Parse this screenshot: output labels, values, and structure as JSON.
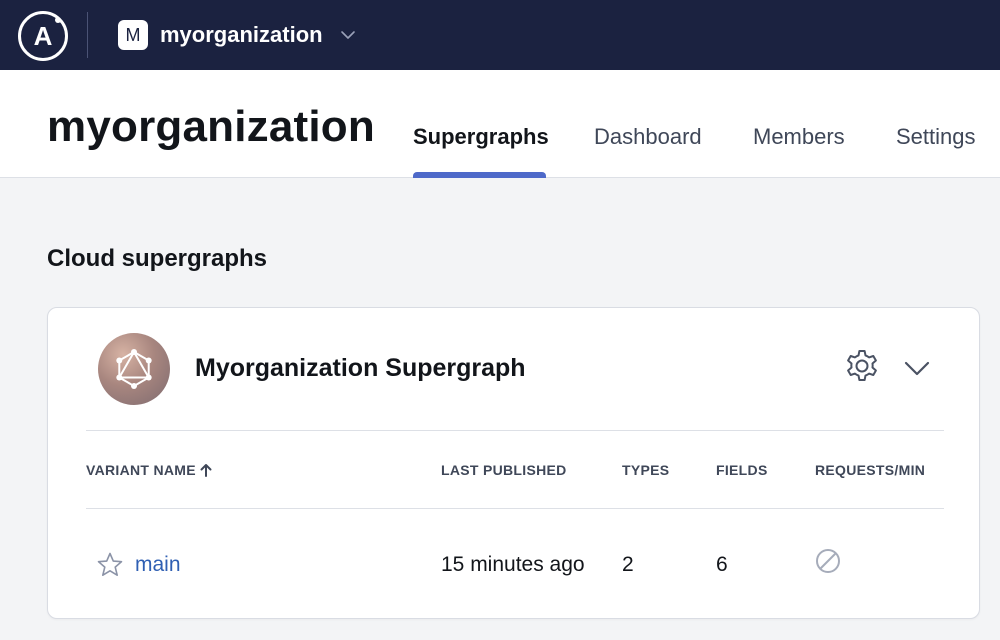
{
  "topbar": {
    "logo_letter": "A",
    "org_initial": "M",
    "org_name": "myorganization"
  },
  "header": {
    "title": "myorganization",
    "tabs": [
      {
        "label": "Supergraphs",
        "active": true
      },
      {
        "label": "Dashboard",
        "active": false
      },
      {
        "label": "Members",
        "active": false
      },
      {
        "label": "Settings",
        "active": false
      }
    ]
  },
  "section": {
    "title": "Cloud supergraphs"
  },
  "card": {
    "graph_name": "Myorganization Supergraph",
    "columns": {
      "variant_name": "VARIANT NAME",
      "last_published": "LAST PUBLISHED",
      "types": "TYPES",
      "fields": "FIELDS",
      "requests_min": "REQUESTS/MIN"
    },
    "rows": [
      {
        "variant": "main",
        "last_published": "15 minutes ago",
        "types": "2",
        "fields": "6"
      }
    ]
  },
  "colors": {
    "topbar": "#1b2240",
    "accent": "#4e69c9",
    "link": "#2f5fb3"
  },
  "icons": {
    "logo": "apollo-logo-icon",
    "org_switch": "chevron-down-icon",
    "graph": "graphql-icon",
    "settings": "gear-icon",
    "expand": "chevron-down-icon",
    "sort": "arrow-up-icon",
    "favorite": "star-icon",
    "no_requests": "circle-slash-icon"
  }
}
